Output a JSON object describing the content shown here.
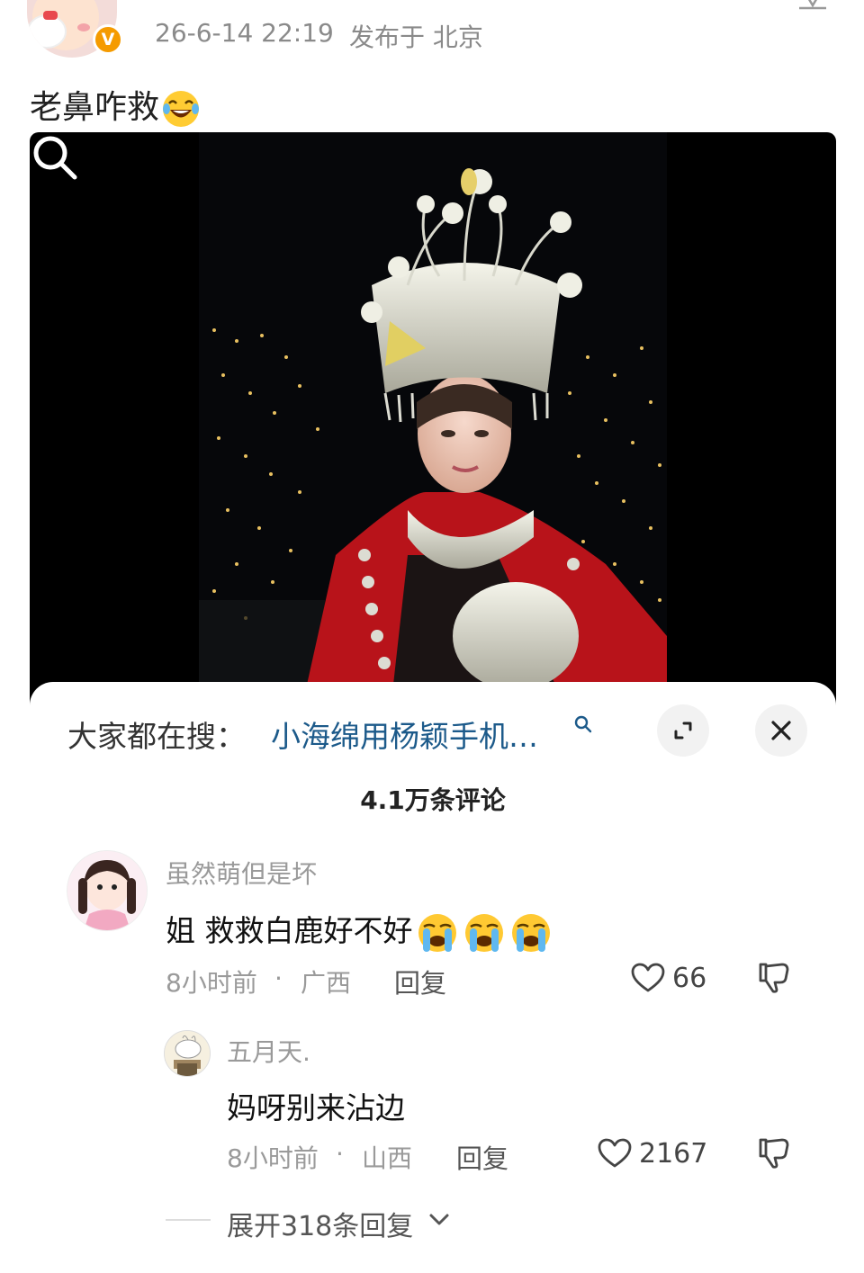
{
  "post": {
    "timestamp": "26-6-14 22:19",
    "location": "发布于 北京",
    "text": "老鼻咋救",
    "vip_badge": "V"
  },
  "sheet": {
    "trending_label": "大家都在搜：",
    "trending_query": "小海绵用杨颖手机…",
    "comments_count": "4.1万条评论"
  },
  "comment": {
    "author": "虽然萌但是坏",
    "text": "姐 救救白鹿好不好",
    "time": "8小时前",
    "dot": "·",
    "region": "广西",
    "reply_label": "回复",
    "likes": "66"
  },
  "reply": {
    "author": "五月天.",
    "text": "妈呀别来沾边",
    "time": "8小时前",
    "dot": "·",
    "region": "山西",
    "reply_label": "回复",
    "likes": "2167"
  },
  "expand_replies_label": "展开318条回复",
  "colors": {
    "link_blue": "#1c5a8a",
    "muted_gray": "#9a9a9a",
    "vip_orange": "#f59b00"
  }
}
